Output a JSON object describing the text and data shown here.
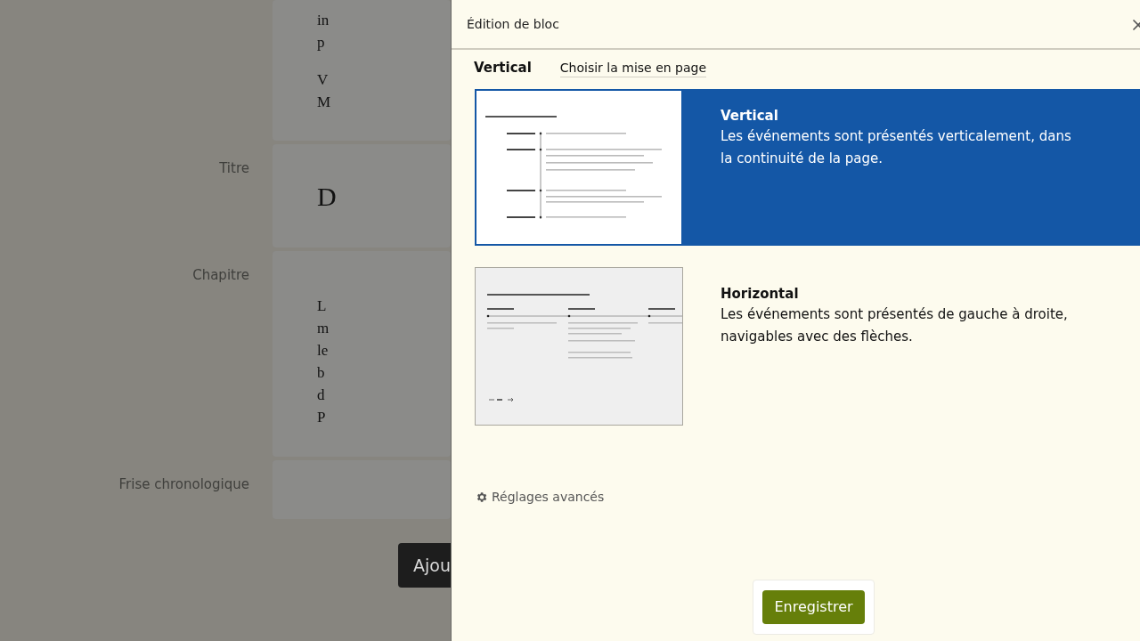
{
  "form": {
    "fields": [
      {
        "kind": "text",
        "lines": [
          "in",
          "p",
          "V",
          "M"
        ]
      },
      {
        "kind": "heading",
        "label": "Titre",
        "lines": [
          "D"
        ]
      },
      {
        "kind": "text",
        "label": "Chapitre",
        "lines": [
          "L",
          "m",
          "le",
          "b",
          "d",
          "P"
        ]
      },
      {
        "kind": "empty",
        "label": "Frise chronologique"
      }
    ],
    "button": "Ajou"
  },
  "panel": {
    "title": "Édition de bloc",
    "current_layout": "Vertical",
    "choose_label": "Choisir la mise en page",
    "options": [
      {
        "kind": "vertical",
        "name": "Vertical",
        "description": "Les événements sont présentés verticalement, dans la continuité de la page.",
        "selected": true
      },
      {
        "kind": "horizontal",
        "name": "Horizontal",
        "description": "Les événements sont présentés de gauche à droite, navigables avec des flèches.",
        "selected": false
      }
    ],
    "advanced": "Réglages avancés",
    "save": "Enregistrer"
  }
}
